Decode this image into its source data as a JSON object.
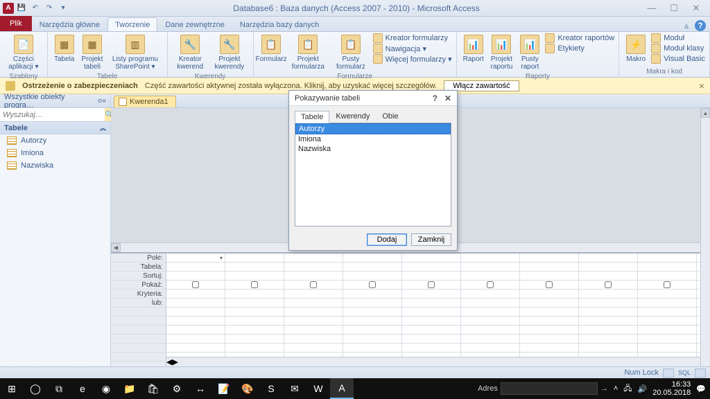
{
  "titlebar": {
    "title": "Database6 : Baza danych (Access 2007 - 2010)  -  Microsoft Access"
  },
  "tabs": {
    "file": "Plik",
    "items": [
      "Narzędzia główne",
      "Tworzenie",
      "Dane zewnętrzne",
      "Narzędzia bazy danych"
    ],
    "active_index": 1
  },
  "ribbon": {
    "groups": [
      {
        "label": "Szablony",
        "big": [
          {
            "icon": "📄",
            "label": "Części\naplikacji ▾"
          }
        ]
      },
      {
        "label": "Tabele",
        "big": [
          {
            "icon": "▦",
            "label": "Tabela"
          },
          {
            "icon": "▦",
            "label": "Projekt\ntabeli"
          },
          {
            "icon": "▥",
            "label": "Listy programu\nSharePoint ▾"
          }
        ]
      },
      {
        "label": "Kwerendy",
        "big": [
          {
            "icon": "🔧",
            "label": "Kreator\nkwerend"
          },
          {
            "icon": "🔧",
            "label": "Projekt\nkwerendy"
          }
        ]
      },
      {
        "label": "Formularze",
        "big": [
          {
            "icon": "📋",
            "label": "Formularz"
          },
          {
            "icon": "📋",
            "label": "Projekt\nformularza"
          },
          {
            "icon": "📋",
            "label": "Pusty\nformularz"
          }
        ],
        "small": [
          "Kreator formularzy",
          "Nawigacja ▾",
          "Więcej formularzy ▾"
        ]
      },
      {
        "label": "Raporty",
        "big": [
          {
            "icon": "📊",
            "label": "Raport"
          },
          {
            "icon": "📊",
            "label": "Projekt\nraportu"
          },
          {
            "icon": "📊",
            "label": "Pusty\nraport"
          }
        ],
        "small": [
          "Kreator raportów",
          "Etykiety"
        ]
      },
      {
        "label": "Makra i kod",
        "big": [
          {
            "icon": "⚡",
            "label": "Makro"
          }
        ],
        "small": [
          "Moduł",
          "Moduł klasy",
          "Visual Basic"
        ]
      }
    ]
  },
  "security": {
    "title": "Ostrzeżenie o zabezpieczeniach",
    "msg": "Część zawartości aktywnej została wyłączona. Kliknij, aby uzyskać więcej szczegółów.",
    "btn": "Włącz zawartość"
  },
  "nav": {
    "header": "Wszystkie obiekty progra…",
    "search_placeholder": "Wyszukaj…",
    "category": "Tabele",
    "items": [
      "Autorzy",
      "Imiona",
      "Nazwiska"
    ]
  },
  "doc_tab": "Kwerenda1",
  "grid_labels": [
    "Pole:",
    "Tabela:",
    "Sortuj:",
    "Pokaż:",
    "Kryteria:",
    "lub:"
  ],
  "dialog": {
    "title": "Pokazywanie tabeli",
    "tabs": [
      "Tabele",
      "Kwerendy",
      "Obie"
    ],
    "active_tab": 0,
    "items": [
      "Autorzy",
      "Imiona",
      "Nazwiska"
    ],
    "selected": 0,
    "add": "Dodaj",
    "close": "Zamknij"
  },
  "status": {
    "numlock": "Num Lock",
    "sql": "SQL"
  },
  "taskbar": {
    "search_label": "Adres",
    "time": "16:33",
    "date": "20.05.2018"
  }
}
